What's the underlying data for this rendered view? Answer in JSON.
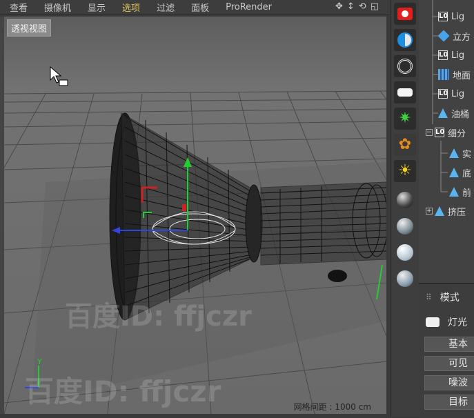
{
  "menubar": {
    "items": [
      "查看",
      "摄像机",
      "显示",
      "选项",
      "过滤",
      "面板",
      "ProRender"
    ],
    "active_item": "选项"
  },
  "viewport": {
    "label": "透视视图",
    "grid_spacing": "网格间距 : 1000 cm",
    "axis_y": "Y",
    "watermark": "百度ID: ffjczr"
  },
  "toolbar": {
    "tools": [
      "camera-icon",
      "contrast-circle-icon",
      "target-ring-icon",
      "area-light-icon",
      "star-icon",
      "flower-icon",
      "sun-icon",
      "sphere-icon",
      "sphere-icon",
      "sphere-icon",
      "sphere-icon"
    ]
  },
  "objects": [
    {
      "name": "Lig",
      "icon": "light-object-icon",
      "indent": 1
    },
    {
      "name": "立方",
      "icon": "cube-icon",
      "indent": 1
    },
    {
      "name": "Lig",
      "icon": "light-object-icon",
      "indent": 1
    },
    {
      "name": "地面",
      "icon": "floor-icon",
      "indent": 1
    },
    {
      "name": "Lig",
      "icon": "light-object-icon",
      "indent": 1
    },
    {
      "name": "油桶",
      "icon": "cone-icon",
      "indent": 1
    },
    {
      "name": "细分",
      "icon": "light-object-icon",
      "indent": 0,
      "expand": "−"
    },
    {
      "name": "实",
      "icon": "cone-icon",
      "indent": 2
    },
    {
      "name": "底",
      "icon": "cone-icon",
      "indent": 2
    },
    {
      "name": "前",
      "icon": "cone-icon",
      "indent": 2
    },
    {
      "name": "挤压",
      "icon": "cone-icon",
      "indent": 0,
      "expand": "+"
    }
  ],
  "attributes": {
    "mode_label": "模式",
    "object_type": "灯光",
    "tabs": [
      "基本",
      "可见",
      "噪波",
      "目标"
    ]
  }
}
